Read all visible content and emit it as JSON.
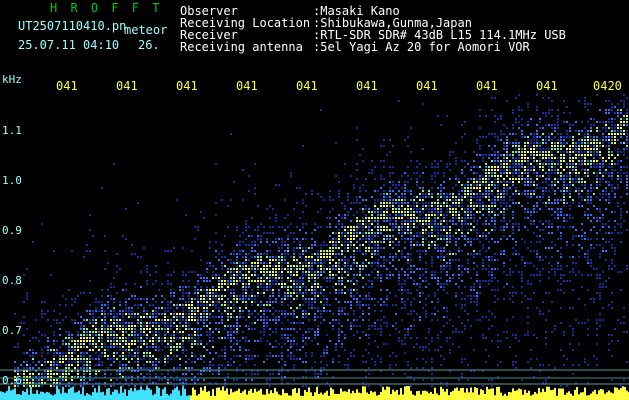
{
  "header": {
    "brand": "H R O F F T",
    "filename": "UT2507110410.pn",
    "mode": "meteor",
    "datetime": "25.07.11 04:10",
    "counter": "26.",
    "fields": [
      {
        "label": "Observer",
        "value": ":Masaki Kano"
      },
      {
        "label": "Receiving Location",
        "value": ":Shibukawa,Gunma,Japan"
      },
      {
        "label": "Receiver",
        "value": ":RTL-SDR SDR# 43dB L15 114.1MHz USB"
      },
      {
        "label": "Receiving antenna",
        "value": ":5el Yagi Az 20 for Aomori VOR"
      }
    ]
  },
  "axis": {
    "unit": "kHz",
    "y_ticks": [
      "1.1",
      "1.0",
      "0.9",
      "0.8",
      "0.7",
      "0.6"
    ],
    "time_ticks": [
      "041",
      "041",
      "041",
      "041",
      "041",
      "041",
      "041",
      "041",
      "041",
      "0420"
    ]
  },
  "colors": {
    "background": "#000000",
    "brand": "#00c800",
    "axis_text": "#99ffff",
    "time_text": "#ffff33",
    "signal_low": "#1030a0",
    "signal_mid": "#3070ff",
    "signal_high": "#7ff0a0",
    "signal_peak": "#ffff40"
  }
}
